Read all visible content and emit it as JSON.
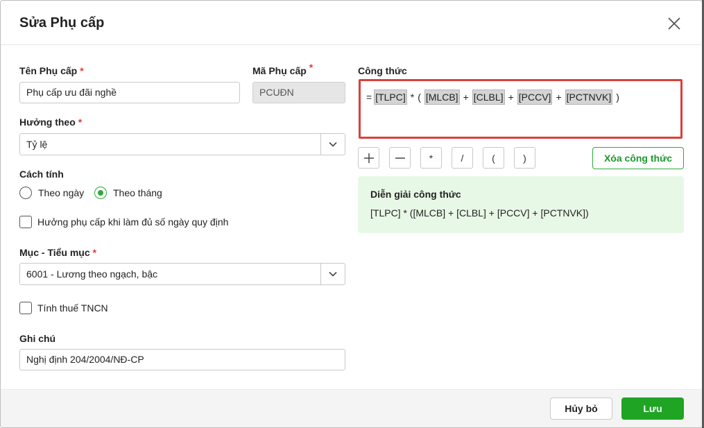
{
  "dialog": {
    "title": "Sửa Phụ cấp"
  },
  "form": {
    "name_label": "Tên Phụ cấp",
    "name_value": "Phụ cấp ưu đãi nghề",
    "code_label": "Mã Phụ cấp",
    "code_value": "PCUĐN",
    "required_mark": "*",
    "basis_label": "Hưởng theo",
    "basis_value": "Tỷ lệ",
    "calc_label": "Cách tính",
    "calc_options": [
      "Theo ngày",
      "Theo tháng"
    ],
    "calc_selected": "Theo tháng",
    "full_days_label": "Hưởng phụ cấp khi làm đủ số ngày quy định",
    "item_label": "Mục - Tiểu mục",
    "item_value": "6001 - Lương theo ngạch, bậc",
    "tax_label": "Tính thuế TNCN",
    "note_label": "Ghi chú",
    "note_value": "Nghị định 204/2004/NĐ-CP"
  },
  "formula": {
    "label": "Công thức",
    "eq": "=",
    "tokens": [
      "[TLPC]",
      "[MLCB]",
      "[CLBL]",
      "[PCCV]",
      "[PCTNVK]"
    ],
    "ops": [
      "*",
      "(",
      "+",
      "+",
      "+",
      ")"
    ],
    "operator_buttons": [
      "+",
      "−",
      "*",
      "/",
      "(",
      ")"
    ],
    "clear_label": "Xóa công thức",
    "explain_title": "Diễn giải công thức",
    "explain_text": "[TLPC] * ([MLCB] + [CLBL] + [PCCV] + [PCTNVK])"
  },
  "footer": {
    "cancel_label": "Hủy bỏ",
    "save_label": "Lưu"
  },
  "colors": {
    "accent": "#1fa424",
    "formula_border": "#d9403a",
    "explain_bg": "#e8f8e6",
    "required": "#e53935"
  },
  "icons": {
    "close": "close-icon",
    "dropdown": "chevron-down-icon"
  }
}
